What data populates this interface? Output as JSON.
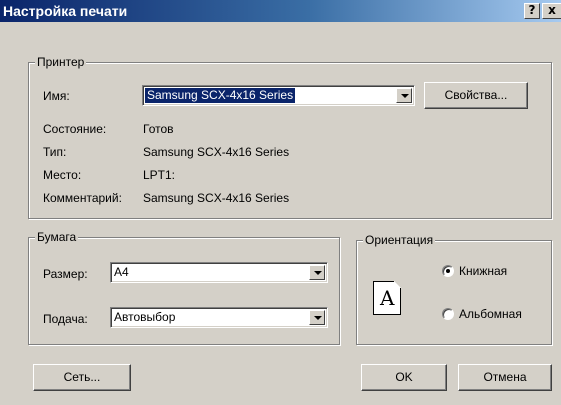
{
  "window": {
    "title": "Настройка печати",
    "help_button": "?",
    "close_button": "x"
  },
  "printer_group": {
    "legend": "Принтер",
    "name_label": "Имя:",
    "name_value": "Samsung SCX-4x16 Series",
    "properties_button": "Свойства...",
    "status_label": "Состояние:",
    "status_value": "Готов",
    "type_label": "Тип:",
    "type_value": "Samsung SCX-4x16 Series",
    "location_label": "Место:",
    "location_value": "LPT1:",
    "comment_label": "Комментарий:",
    "comment_value": "Samsung SCX-4x16 Series"
  },
  "paper_group": {
    "legend": "Бумага",
    "size_label": "Размер:",
    "size_value": "A4",
    "source_label": "Подача:",
    "source_value": "Автовыбор"
  },
  "orientation_group": {
    "legend": "Ориентация",
    "page_icon_letter": "A",
    "portrait_label": "Книжная",
    "landscape_label": "Альбомная",
    "selected": "portrait"
  },
  "buttons": {
    "network": "Сеть...",
    "ok": "OK",
    "cancel": "Отмена"
  },
  "colors": {
    "dialog_bg": "#d4d0c8",
    "titlebar_start": "#0a246a",
    "titlebar_end": "#a6caf0",
    "selection": "#0a246a"
  },
  "icons": {
    "help": "help-icon",
    "close": "close-icon",
    "dropdown": "chevron-down-icon",
    "page": "page-portrait-icon"
  }
}
